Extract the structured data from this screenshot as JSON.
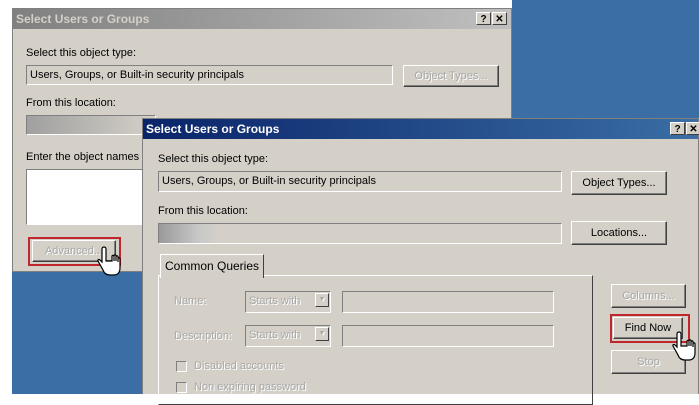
{
  "back_dialog": {
    "title": "Select Users or Groups",
    "help_btn": "?",
    "close_btn": "✕",
    "object_type_label": "Select this object type:",
    "object_type_value": "Users, Groups, or Built-in security principals",
    "object_types_btn": "Object Types...",
    "location_label": "From this location:",
    "enter_names_label": "Enter the object names",
    "advanced_btn": "Advanced..."
  },
  "front_dialog": {
    "title": "Select Users or Groups",
    "help_btn": "?",
    "close_btn": "✕",
    "object_type_label": "Select this object type:",
    "object_type_value": "Users, Groups, or Built-in security principals",
    "object_types_btn": "Object Types...",
    "location_label": "From this location:",
    "locations_btn": "Locations...",
    "tab_common_queries": "Common Queries",
    "name_label": "Name:",
    "name_mode": "Starts with",
    "description_label": "Description:",
    "description_mode": "Starts with",
    "disabled_accounts": "Disabled accounts",
    "non_expiring_password": "Non expiring password",
    "columns_btn": "Columns...",
    "find_now_btn": "Find Now",
    "stop_btn": "Stop"
  },
  "colors": {
    "desktop": "#3a6ea5",
    "title_active": "#0a246a",
    "title_inactive": "#808080",
    "highlight": "#c0272d"
  }
}
